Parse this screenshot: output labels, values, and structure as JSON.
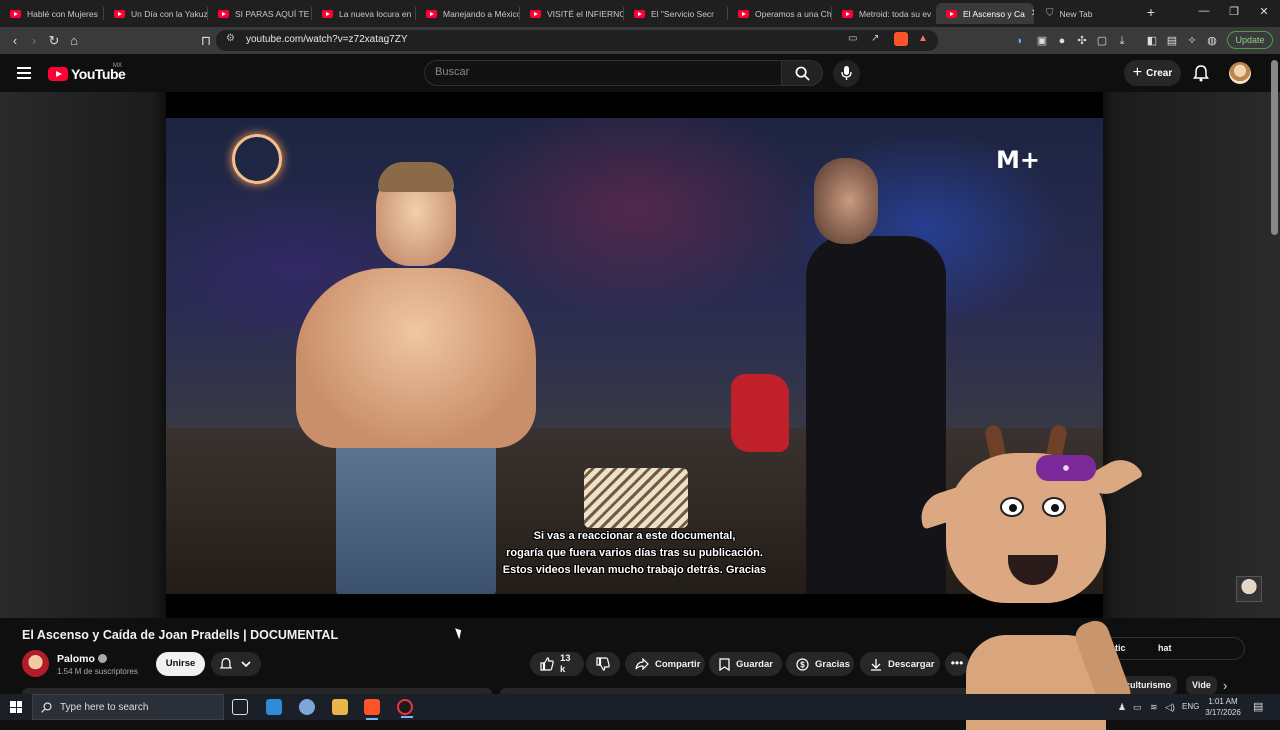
{
  "browser": {
    "tabs": [
      {
        "label": "Hablé con Mujeres"
      },
      {
        "label": "Un Día con la Yakuza"
      },
      {
        "label": "SI PARAS AQUÍ TE M"
      },
      {
        "label": "La nueva locura en"
      },
      {
        "label": "Manejando a México"
      },
      {
        "label": "VISITÉ el INFIERNO"
      },
      {
        "label": "El \"Servicio Secr"
      },
      {
        "label": "Operamos a una Ch"
      },
      {
        "label": "Metroid: toda su ev"
      },
      {
        "label": "El Ascenso y Ca",
        "active": true
      },
      {
        "label": "New Tab"
      }
    ],
    "url": "youtube.com/watch?v=z72xatag7ZY",
    "update_label": "Update",
    "new_tab_symbol": "+"
  },
  "youtube": {
    "logo_text": "YouTube",
    "region": "MX",
    "search_placeholder": "Buscar",
    "create_label": "Crear"
  },
  "player": {
    "subtitles": [
      "Si vas a reaccionar a este documental,",
      "rogaría que fuera varios días tras su publicación.",
      "Estos videos llevan mucho trabajo detrás. Gracias"
    ],
    "watermark": "M+"
  },
  "video": {
    "title": "El Ascenso y Caída de Joan Pradells | DOCUMENTAL",
    "channel_name": "Palomo",
    "subscribers": "1.54 M de suscriptores",
    "join_label": "Unirse",
    "likes": "13 k",
    "share_label": "Compartir",
    "save_label": "Guardar",
    "thanks_label": "Gracias",
    "download_label": "Descargar",
    "more_symbol": "•••"
  },
  "side": {
    "chat_fragment_a": "etic",
    "chat_fragment_b": "hat",
    "chip_a": "icoculturismo",
    "chip_b": "Vide"
  },
  "taskbar": {
    "search_placeholder": "Type here to search",
    "language": "ENG",
    "time": "1:01 AM",
    "date": "3/17/2026"
  },
  "colors": {
    "youtube_red": "#ff0033",
    "background": "#0f0f0f",
    "pill_bg": "#272727",
    "update_green": "#4a9e4a"
  }
}
